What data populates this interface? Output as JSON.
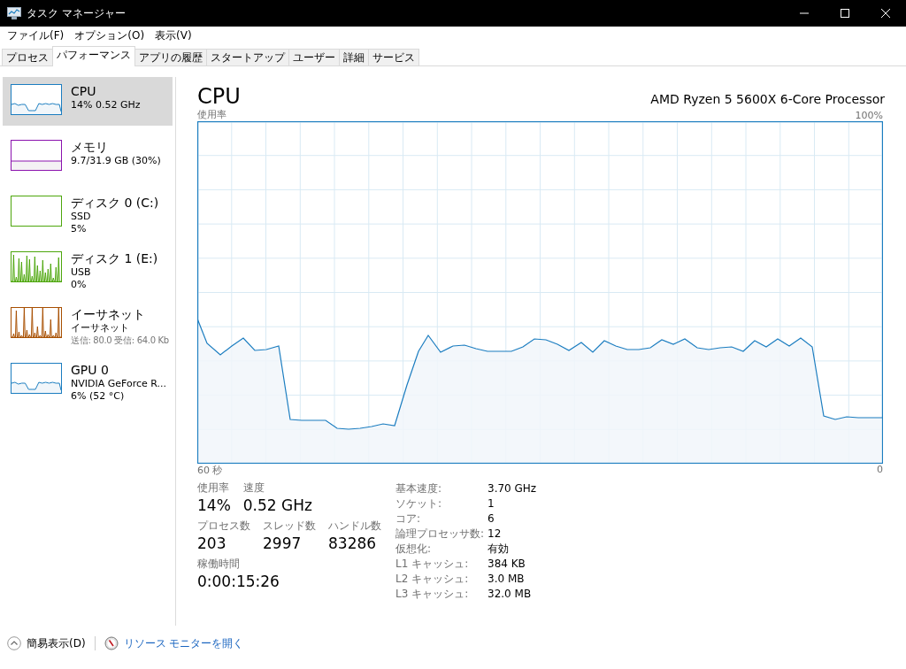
{
  "window": {
    "title": "タスク マネージャー"
  },
  "menu": [
    "ファイル(F)",
    "オプション(O)",
    "表示(V)"
  ],
  "tabs": [
    {
      "label": "プロセス",
      "selected": false
    },
    {
      "label": "パフォーマンス",
      "selected": true
    },
    {
      "label": "アプリの履歴",
      "selected": false
    },
    {
      "label": "スタートアップ",
      "selected": false
    },
    {
      "label": "ユーザー",
      "selected": false
    },
    {
      "label": "詳細",
      "selected": false
    },
    {
      "label": "サービス",
      "selected": false
    }
  ],
  "sidebar": {
    "items": [
      {
        "kind": "cpu",
        "name": "CPU",
        "details": [
          "14%  0.52 GHz"
        ],
        "color": "#1b7dc0",
        "selected": true
      },
      {
        "kind": "memory",
        "name": "メモリ",
        "details": [
          "9.7/31.9 GB (30%)"
        ],
        "color": "#8b12ae",
        "selected": false
      },
      {
        "kind": "disk-idle",
        "name": "ディスク 0 (C:)",
        "details": [
          "SSD",
          "5%"
        ],
        "color": "#4da60c",
        "selected": false
      },
      {
        "kind": "disk-busy",
        "name": "ディスク 1 (E:)",
        "details": [
          "USB",
          "0%"
        ],
        "color": "#4da60c",
        "selected": false
      },
      {
        "kind": "network",
        "name": "イーサネット",
        "details": [
          "イーサネット",
          "送信: 80.0 受信: 64.0 Kb"
        ],
        "color": "#a74f01",
        "selected": false
      },
      {
        "kind": "gpu",
        "name": "GPU 0",
        "details": [
          "NVIDIA GeForce R...",
          "6% (52 °C)"
        ],
        "color": "#1b7dc0",
        "selected": false
      }
    ]
  },
  "panel": {
    "title": "CPU",
    "processor": "AMD Ryzen 5 5600X 6-Core Processor",
    "graph": {
      "y_label": "使用率",
      "y_max_label": "100%",
      "x_start_label": "60 秒",
      "x_end_label": "0"
    },
    "stat_rows": [
      [
        {
          "label": "使用率",
          "value": "14%"
        },
        {
          "label": "速度",
          "value": "0.52 GHz"
        }
      ],
      [
        {
          "label": "プロセス数",
          "value": "203"
        },
        {
          "label": "スレッド数",
          "value": "2997"
        },
        {
          "label": "ハンドル数",
          "value": "83286"
        }
      ],
      [
        {
          "label": "稼働時間",
          "value": "0:00:15:26"
        }
      ]
    ],
    "specs": [
      {
        "label": "基本速度:",
        "value": "3.70 GHz"
      },
      {
        "label": "ソケット:",
        "value": "1"
      },
      {
        "label": "コア:",
        "value": "6"
      },
      {
        "label": "論理プロセッサ数:",
        "value": "12"
      },
      {
        "label": "仮想化:",
        "value": "有効"
      },
      {
        "label": "L1 キャッシュ:",
        "value": "384 KB"
      },
      {
        "label": "L2 キャッシュ:",
        "value": "3.0 MB"
      },
      {
        "label": "L3 キャッシュ:",
        "value": "32.0 MB"
      }
    ]
  },
  "footer": {
    "fewer_details": "簡易表示(D)",
    "link": "リソース モニターを開く"
  }
}
